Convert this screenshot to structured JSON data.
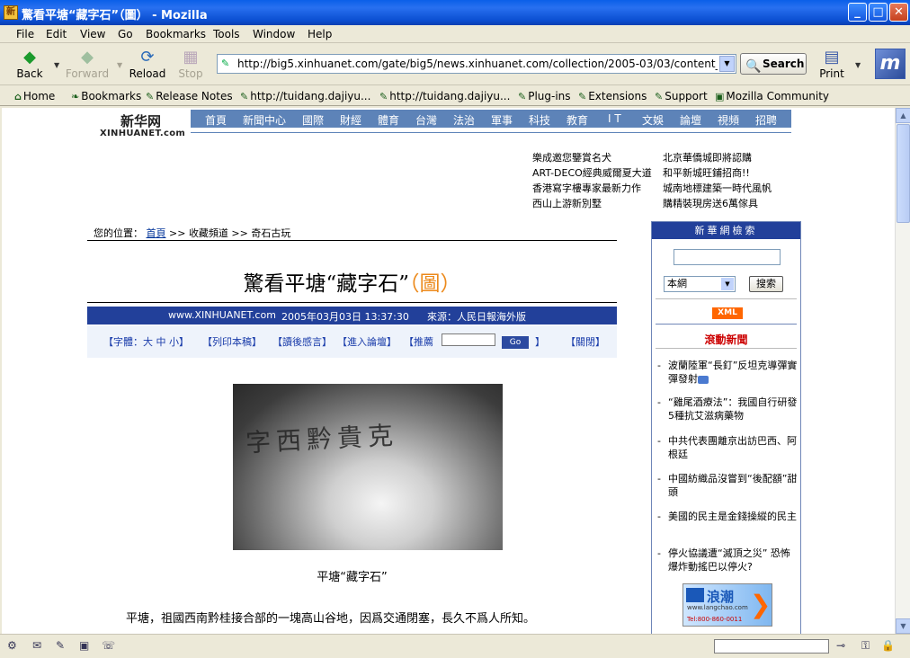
{
  "window": {
    "title": "驚看平塘“藏字石”（圖） - Mozilla"
  },
  "menu": [
    "File",
    "Edit",
    "View",
    "Go",
    "Bookmarks",
    "Tools",
    "Window",
    "Help"
  ],
  "nav": {
    "back": "Back",
    "forward": "Forward",
    "reload": "Reload",
    "stop": "Stop",
    "url": "http://big5.xinhuanet.com/gate/big5/news.xinhuanet.com/collection/2005-03/03/content_2643",
    "search": "Search",
    "print": "Print"
  },
  "bookmarks": [
    "Home",
    "Bookmarks",
    "Release Notes",
    "http://tuidang.dajiyu...",
    "http://tuidang.dajiyu...",
    "Plug-ins",
    "Extensions",
    "Support",
    "Mozilla Community"
  ],
  "site": {
    "logo_cn": "新华网",
    "logo_en": "XINHUANET.com",
    "topnav": [
      "首頁",
      "新聞中心",
      "國際",
      "財經",
      "體育",
      "台灣",
      "法治",
      "軍事",
      "科技",
      "教育",
      "I T",
      "文娛",
      "論壇",
      "視頻",
      "招聘"
    ],
    "ads_left": [
      "樂成邀您鑒賞名犬",
      "ART-DECO經典威爾夏大道",
      "香港寫字樓專家最新力作",
      "西山上游新別墅"
    ],
    "ads_right": [
      "北京華僑城即將認購",
      "和平新城旺鋪招商!!",
      "城南地標建築一時代風帆",
      "購精裝現房送6萬傢具"
    ]
  },
  "breadcrumb": {
    "prefix": "您的位置：",
    "home": "首頁",
    "sep1": " >> ",
    "cat": "收藏頻道",
    "sep2": " >> ",
    "sub": "奇石古玩"
  },
  "article": {
    "title_main": "驚看平塘“藏字石”",
    "title_pic": "（圖）",
    "meta_site": "www.XINHUANET.com",
    "meta_time": "2005年03月03日 13:37:30",
    "meta_source": "來源：人民日報海外版",
    "tool_font": "【字體：大 中 小】",
    "tool_print": "【列印本稿】",
    "tool_comment": "【讀後感言】",
    "tool_forum": "【進入論壇】",
    "tool_recommend": "【推薦",
    "tool_go": "Go",
    "tool_close_bracket": "】",
    "tool_close": "【關閉】",
    "photo_text": "字西黔貴克",
    "caption": "平塘“藏字石”",
    "para": "平塘，祖國西南黔桂接合部的一塊高山谷地，因爲交通閉塞，長久不爲人所知。"
  },
  "sidebar": {
    "header": "新華網檢索",
    "select": "本網",
    "search_btn": "搜索",
    "xml": "XML",
    "rolling_title": "滾動新聞",
    "news": [
      "波蘭陸軍“長釘”反坦克導彈實彈發射",
      "“雞尾酒療法”：我國自行研發5種抗艾滋病藥物",
      "中共代表團離京出訪巴西、阿根廷",
      "中國紡織品沒嘗到“後配額”甜頭",
      "美國的民主是金錢操縱的民主",
      "停火協議遭“滅頂之災” 恐怖爆炸動搖巴以停火?"
    ],
    "banner_logo": "浪潮",
    "banner_site": "www.langchao.com",
    "banner_tel": "Tel:800-860-0011"
  }
}
